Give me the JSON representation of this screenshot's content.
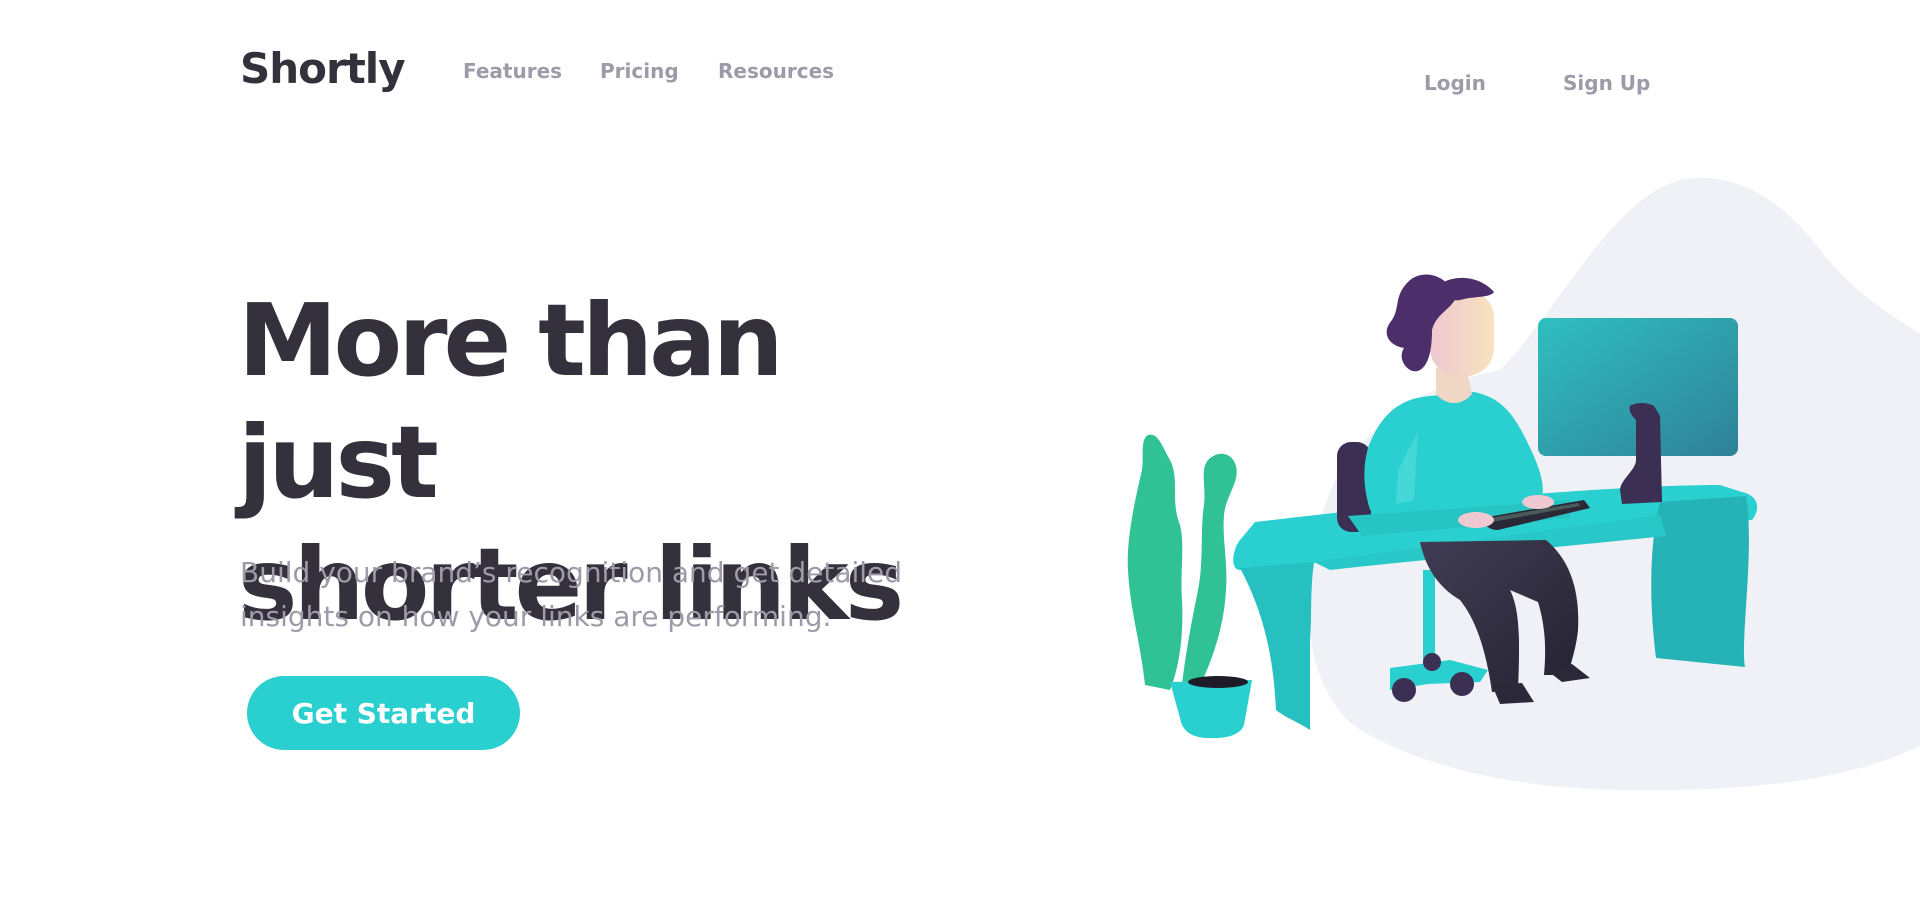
{
  "header": {
    "logo": "Shortly",
    "nav": {
      "features": "Features",
      "pricing": "Pricing",
      "resources": "Resources"
    },
    "auth": {
      "login": "Login",
      "signup": "Sign Up"
    }
  },
  "hero": {
    "title_line1": "More than just",
    "title_line2": "shorter links",
    "subtitle_line1": "Build your brand’s recognition and get detailed",
    "subtitle_line2": "insights on how your links are performing.",
    "cta": "Get Started"
  },
  "colors": {
    "primary": "#2acfcf",
    "dark": "#34313d",
    "gray": "#9e9aa8",
    "blob": "#eff1f7",
    "purple": "#3b3054"
  }
}
